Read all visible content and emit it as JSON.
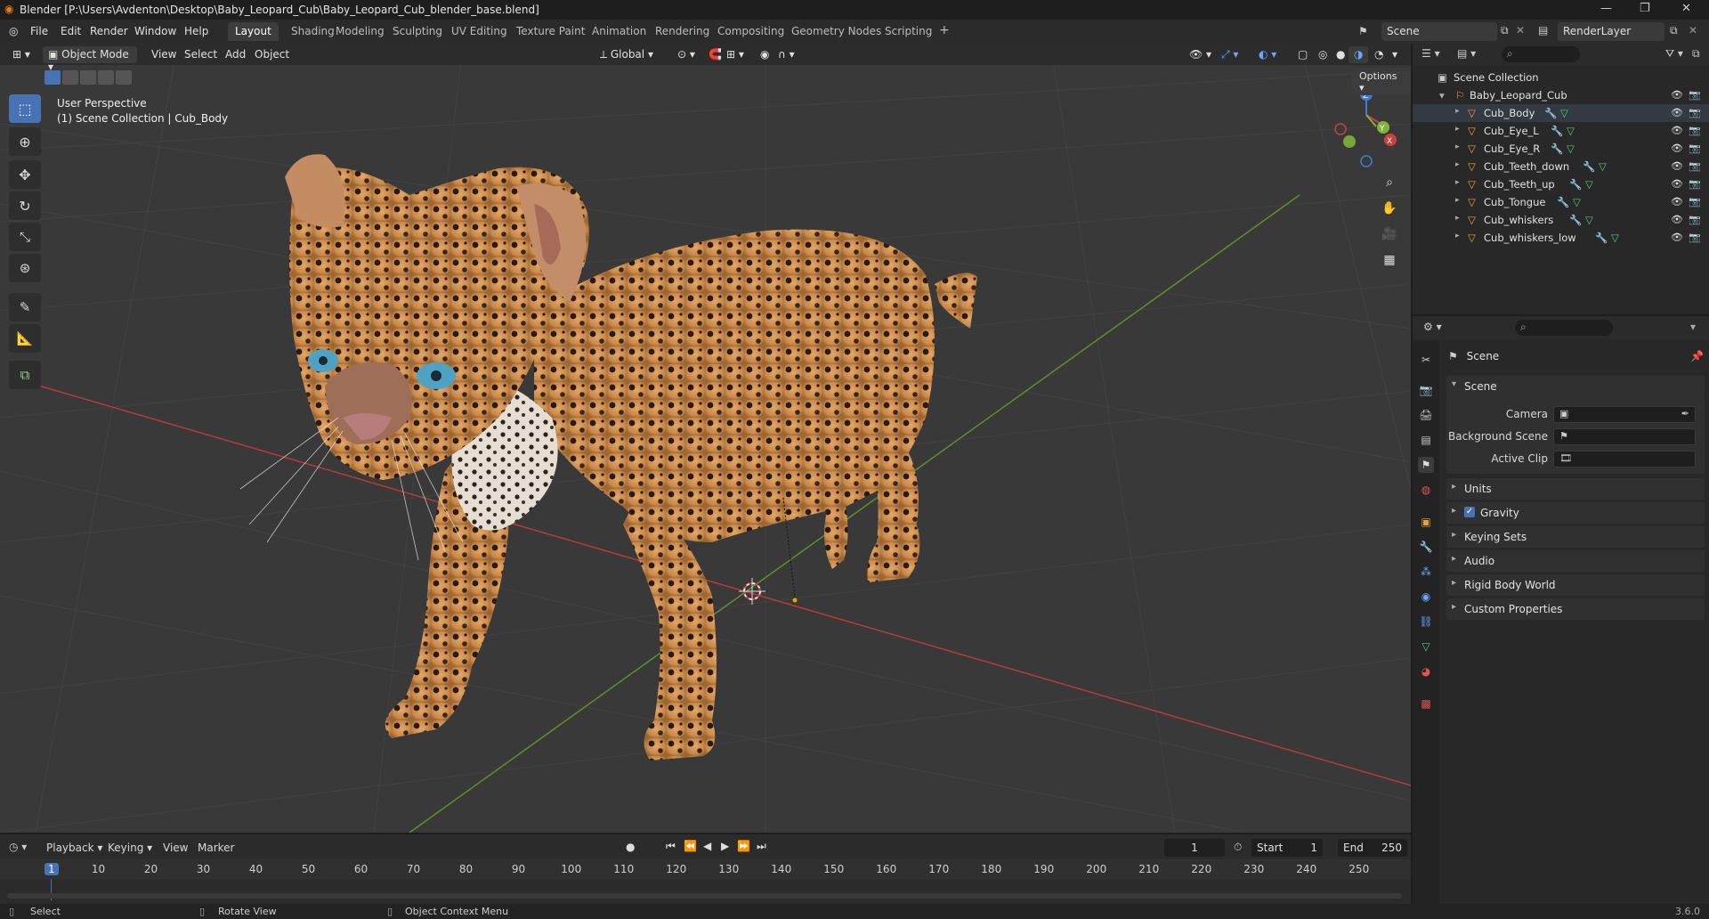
{
  "window": {
    "title": "Blender [P:\\Users\\Avdenton\\Desktop\\Baby_Leopard_Cub\\Baby_Leopard_Cub_blender_base.blend]",
    "controls": [
      "—",
      "❐",
      "✕"
    ]
  },
  "menu": [
    "File",
    "Edit",
    "Render",
    "Window",
    "Help"
  ],
  "workspaces": [
    "Layout",
    "Shading",
    "Modeling",
    "Sculpting",
    "UV Editing",
    "Texture Paint",
    "Animation",
    "Rendering",
    "Compositing",
    "Geometry Nodes",
    "Scripting"
  ],
  "workspace_add": "+",
  "scene_name": "Scene",
  "view_layer": "RenderLayer",
  "viewport": {
    "mode": "Object Mode",
    "menus": [
      "View",
      "Select",
      "Add",
      "Object"
    ],
    "transform_orientation": "Global",
    "options_label": "Options",
    "info_line1": "User Perspective",
    "info_line2": "(1) Scene Collection | Cub_Body",
    "gizmo_axes": {
      "x": "X",
      "y": "Y",
      "z": "Z"
    },
    "colors": {
      "x_axis": "#c9413f",
      "y_axis": "#7fb33a",
      "z_axis": "#3d7fd6",
      "grid_bg": "#393939"
    }
  },
  "outliner": {
    "root": "Scene Collection",
    "collection": "Baby_Leopard_Cub",
    "objects": [
      "Cub_Body",
      "Cub_Eye_L",
      "Cub_Eye_R",
      "Cub_Teeth_down",
      "Cub_Teeth_up",
      "Cub_Tongue",
      "Cub_whiskers",
      "Cub_whiskers_low"
    ]
  },
  "properties": {
    "context": "Scene",
    "section": "Scene",
    "fields": [
      {
        "label": "Camera",
        "value": ""
      },
      {
        "label": "Background Scene",
        "value": ""
      },
      {
        "label": "Active Clip",
        "value": ""
      }
    ],
    "panels": [
      "Units",
      "Gravity",
      "Keying Sets",
      "Audio",
      "Rigid Body World",
      "Custom Properties"
    ],
    "gravity_checked": true
  },
  "timeline": {
    "menus": [
      "Playback",
      "Keying",
      "View",
      "Marker"
    ],
    "current_frame": "1",
    "start_label": "Start",
    "start": "1",
    "end_label": "End",
    "end": "250",
    "ticks": [
      "1",
      "10",
      "20",
      "30",
      "40",
      "50",
      "60",
      "70",
      "80",
      "90",
      "100",
      "110",
      "120",
      "130",
      "140",
      "150",
      "160",
      "170",
      "180",
      "190",
      "200",
      "210",
      "220",
      "230",
      "240",
      "250"
    ]
  },
  "statusbar": {
    "select": "Select",
    "rotate": "Rotate View",
    "context_menu": "Object Context Menu",
    "version": "3.6.0"
  }
}
